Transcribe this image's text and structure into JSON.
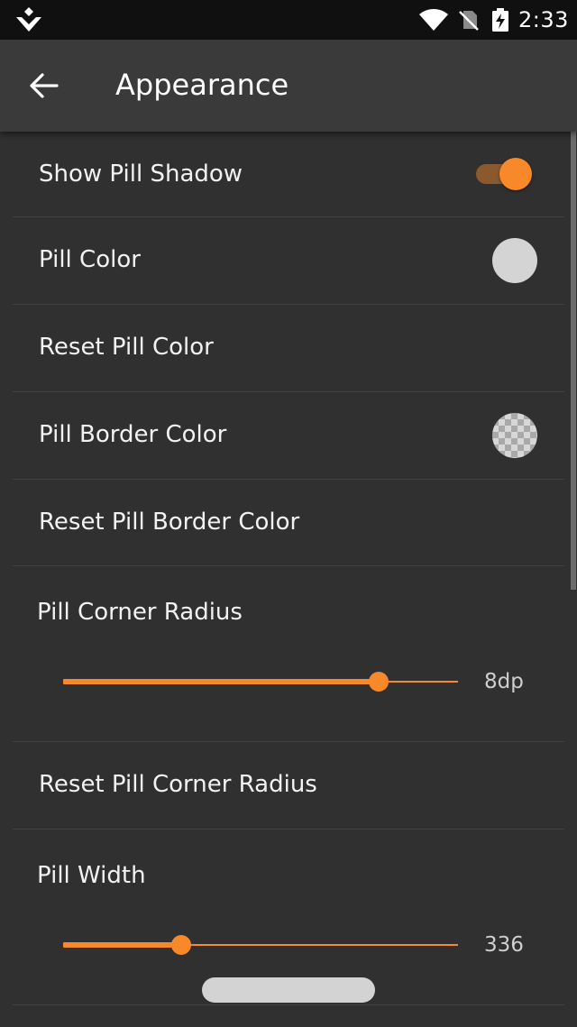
{
  "status_bar": {
    "time": "2:33",
    "icons": [
      "app-notification-icon",
      "wifi-icon",
      "no-sim-icon",
      "battery-charging-icon"
    ]
  },
  "app_bar": {
    "back_icon": "arrow-left-icon",
    "title": "Appearance"
  },
  "settings": [
    {
      "label": "Show Pill Shadow",
      "control": "toggle",
      "checked": true
    },
    {
      "label": "Pill Color",
      "control": "color-swatch",
      "color": "#d4d4d4"
    },
    {
      "label": "Reset Pill Color"
    },
    {
      "label": "Pill Border Color",
      "control": "color-swatch",
      "color": "transparent"
    },
    {
      "label": "Reset Pill Border Color"
    },
    {
      "label": "Pill Corner Radius",
      "control": "slider",
      "value_text": "8dp",
      "fraction": 0.8
    },
    {
      "label": "Reset Pill Corner Radius"
    },
    {
      "label": "Pill Width",
      "control": "slider",
      "value_text": "336",
      "fraction": 0.3
    }
  ],
  "colors": {
    "accent": "#f7892b",
    "background": "#303030",
    "app_bar": "#3a3a3a",
    "status_bar": "#101010",
    "divider": "#434343"
  }
}
